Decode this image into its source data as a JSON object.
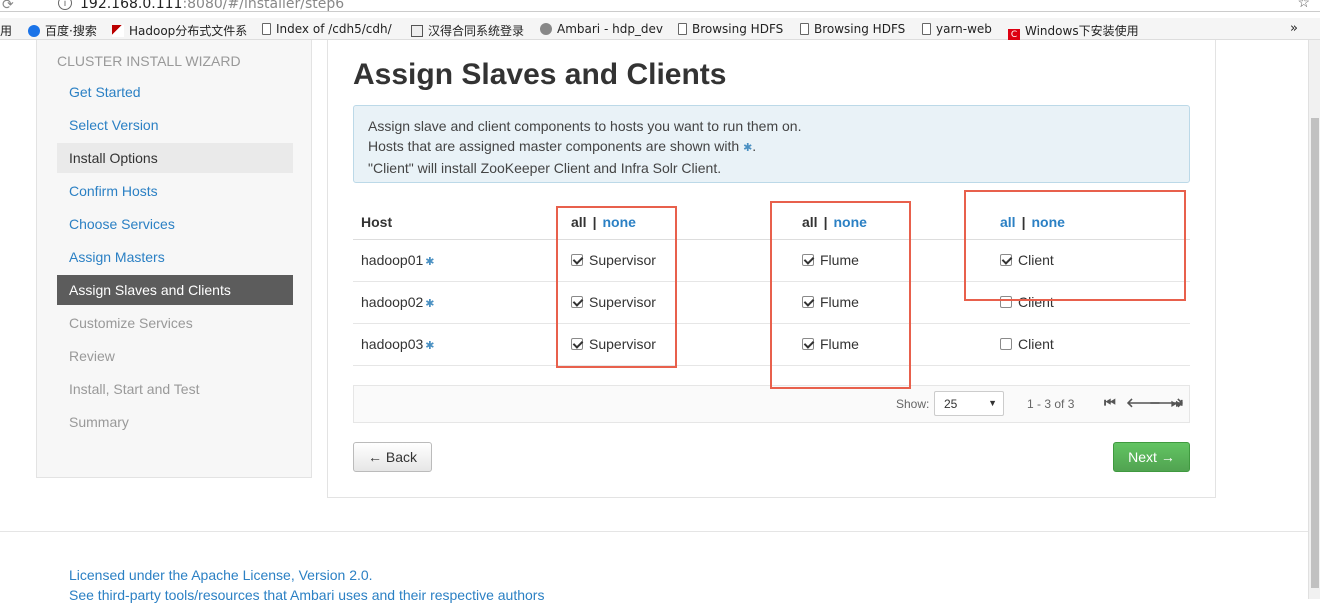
{
  "browser": {
    "url_host": "192.168.0.111",
    "url_rest": ":8080/#/installer/step6",
    "bookmarks": [
      {
        "label": "用",
        "icon": "apps-fragment"
      },
      {
        "label": "百度·搜索",
        "icon": "ie-icon"
      },
      {
        "label": "Hadoop分布式文件系",
        "icon": "hadoop-icon"
      },
      {
        "label": "Index of /cdh5/cdh/",
        "icon": "page-icon"
      },
      {
        "label": "汉得合同系统登录",
        "icon": "image-icon"
      },
      {
        "label": "Ambari - hdp_dev",
        "icon": "ambari-icon"
      },
      {
        "label": "Browsing HDFS",
        "icon": "page-icon"
      },
      {
        "label": "Browsing HDFS",
        "icon": "page-icon"
      },
      {
        "label": "yarn-web",
        "icon": "page-icon"
      },
      {
        "label": "Windows下安装使用",
        "icon": "red-c-icon"
      }
    ],
    "more": "»"
  },
  "sidebar": {
    "header": "CLUSTER INSTALL WIZARD",
    "items": [
      {
        "label": "Get Started",
        "state": "link"
      },
      {
        "label": "Select Version",
        "state": "link"
      },
      {
        "label": "Install Options",
        "state": "light"
      },
      {
        "label": "Confirm Hosts",
        "state": "link"
      },
      {
        "label": "Choose Services",
        "state": "link"
      },
      {
        "label": "Assign Masters",
        "state": "link"
      },
      {
        "label": "Assign Slaves and Clients",
        "state": "active"
      },
      {
        "label": "Customize Services",
        "state": "disabled"
      },
      {
        "label": "Review",
        "state": "disabled"
      },
      {
        "label": "Install, Start and Test",
        "state": "disabled"
      },
      {
        "label": "Summary",
        "state": "disabled"
      }
    ]
  },
  "main": {
    "title": "Assign Slaves and Clients",
    "info_lines": [
      "Assign slave and client components to hosts you want to run them on.",
      "Hosts that are assigned master components are shown with",
      "\"Client\" will install ZooKeeper Client and Infra Solr Client."
    ],
    "info_star": "✱",
    "info_period": ".",
    "table": {
      "host_header": "Host",
      "all_label": "all",
      "none_label": "none",
      "separator": "|",
      "host_star": "✱",
      "rows": [
        {
          "host": "hadoop01",
          "supervisor": {
            "label": "Supervisor",
            "checked": true
          },
          "flume": {
            "label": "Flume",
            "checked": true
          },
          "client": {
            "label": "Client",
            "checked": true
          }
        },
        {
          "host": "hadoop02",
          "supervisor": {
            "label": "Supervisor",
            "checked": true
          },
          "flume": {
            "label": "Flume",
            "checked": true
          },
          "client": {
            "label": "Client",
            "checked": false
          }
        },
        {
          "host": "hadoop03",
          "supervisor": {
            "label": "Supervisor",
            "checked": true
          },
          "flume": {
            "label": "Flume",
            "checked": true
          },
          "client": {
            "label": "Client",
            "checked": false
          }
        }
      ]
    },
    "pager": {
      "show_label": "Show:",
      "page_size": "25",
      "count": "1 - 3 of 3"
    },
    "back_label": "← Back",
    "next_label": "Next →"
  },
  "footer": {
    "license": "Licensed under the Apache License, Version 2.0.",
    "third_party": "See third-party tools/resources that Ambari uses and their respective authors"
  },
  "colors": {
    "link": "#2b80c4",
    "active_nav": "#5c5c5c",
    "annotation_box": "#e8604c",
    "next_button": "#5bb75b"
  }
}
